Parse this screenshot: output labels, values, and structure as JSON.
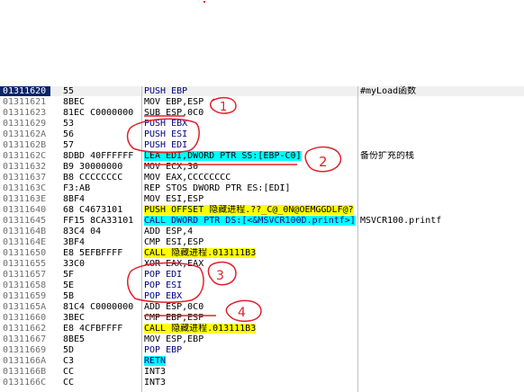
{
  "colors": {
    "selection_bg": "#0a246a",
    "call_highlight": "#ffff00",
    "keyword_highlight": "#00ffff",
    "annotation_red": "#e0202a"
  },
  "rows": [
    {
      "addr": "01311620",
      "hex": "55",
      "asm": "PUSH EBP",
      "comment": "#myLoad函数",
      "style": "push",
      "selected": true
    },
    {
      "addr": "01311621",
      "hex": "8BEC",
      "asm": "MOV EBP,ESP",
      "comment": "",
      "style": "plain"
    },
    {
      "addr": "01311623",
      "hex": "81EC C0000000",
      "asm": "SUB ESP,0C0",
      "comment": "",
      "style": "plain"
    },
    {
      "addr": "01311629",
      "hex": "53",
      "asm": "PUSH EBX",
      "comment": "",
      "style": "push"
    },
    {
      "addr": "0131162A",
      "hex": "56",
      "asm": "PUSH ESI",
      "comment": "",
      "style": "push"
    },
    {
      "addr": "0131162B",
      "hex": "57",
      "asm": "PUSH EDI",
      "comment": "",
      "style": "push"
    },
    {
      "addr": "0131162C",
      "hex": "8DBD 40FFFFFF",
      "asm": "LEA EDI,DWORD PTR SS:[EBP-C0]",
      "comment": "备份扩充的栈",
      "style": "lea"
    },
    {
      "addr": "01311632",
      "hex": "B9 30000000",
      "asm": "MOV ECX,30",
      "comment": "",
      "style": "plain"
    },
    {
      "addr": "01311637",
      "hex": "B8 CCCCCCCC",
      "asm": "MOV EAX,CCCCCCCC",
      "comment": "",
      "style": "plain"
    },
    {
      "addr": "0131163C",
      "hex": "F3:AB",
      "asm": "REP STOS DWORD PTR ES:[EDI]",
      "comment": "",
      "style": "plain"
    },
    {
      "addr": "0131163E",
      "hex": "8BF4",
      "asm": "MOV ESI,ESP",
      "comment": "",
      "style": "plain"
    },
    {
      "addr": "01311640",
      "hex": "68 C4673101",
      "asm": "PUSH OFFSET 隐藏进程.??_C@_0N@OEMGGDLF@?",
      "comment": "",
      "style": "pushoffset"
    },
    {
      "addr": "01311645",
      "hex": "FF15 8CA33101",
      "asm": "CALL DWORD PTR DS:[<&MSVCR100D.printf>]",
      "comment": "MSVCR100.printf",
      "style": "callptr"
    },
    {
      "addr": "0131164B",
      "hex": "83C4 04",
      "asm": "ADD ESP,4",
      "comment": "",
      "style": "plain"
    },
    {
      "addr": "0131164E",
      "hex": "3BF4",
      "asm": "CMP ESI,ESP",
      "comment": "",
      "style": "plain"
    },
    {
      "addr": "01311650",
      "hex": "E8 5EFBFFFF",
      "asm": "CALL 隐藏进程.013111B3",
      "comment": "",
      "style": "call"
    },
    {
      "addr": "01311655",
      "hex": "33C0",
      "asm": "XOR EAX,EAX",
      "comment": "",
      "style": "plain"
    },
    {
      "addr": "01311657",
      "hex": "5F",
      "asm": "POP EDI",
      "comment": "",
      "style": "push"
    },
    {
      "addr": "01311658",
      "hex": "5E",
      "asm": "POP ESI",
      "comment": "",
      "style": "push"
    },
    {
      "addr": "01311659",
      "hex": "5B",
      "asm": "POP EBX",
      "comment": "",
      "style": "push"
    },
    {
      "addr": "0131165A",
      "hex": "81C4 C0000000",
      "asm": "ADD ESP,0C0",
      "comment": "",
      "style": "plain"
    },
    {
      "addr": "01311660",
      "hex": "3BEC",
      "asm": "CMP EBP,ESP",
      "comment": "",
      "style": "plain"
    },
    {
      "addr": "01311662",
      "hex": "E8 4CFBFFFF",
      "asm": "CALL 隐藏进程.013111B3",
      "comment": "",
      "style": "call"
    },
    {
      "addr": "01311667",
      "hex": "8BE5",
      "asm": "MOV ESP,EBP",
      "comment": "",
      "style": "plain"
    },
    {
      "addr": "01311669",
      "hex": "5D",
      "asm": "POP EBP",
      "comment": "",
      "style": "push"
    },
    {
      "addr": "0131166A",
      "hex": "C3",
      "asm": "RETN",
      "comment": "",
      "style": "retn"
    },
    {
      "addr": "0131166B",
      "hex": "CC",
      "asm": "INT3",
      "comment": "",
      "style": "plain"
    },
    {
      "addr": "0131166C",
      "hex": "CC",
      "asm": "INT3",
      "comment": "",
      "style": "plain"
    }
  ],
  "annotations": {
    "label_1": "1",
    "label_2": "2",
    "label_3": "3",
    "label_4": "4"
  }
}
